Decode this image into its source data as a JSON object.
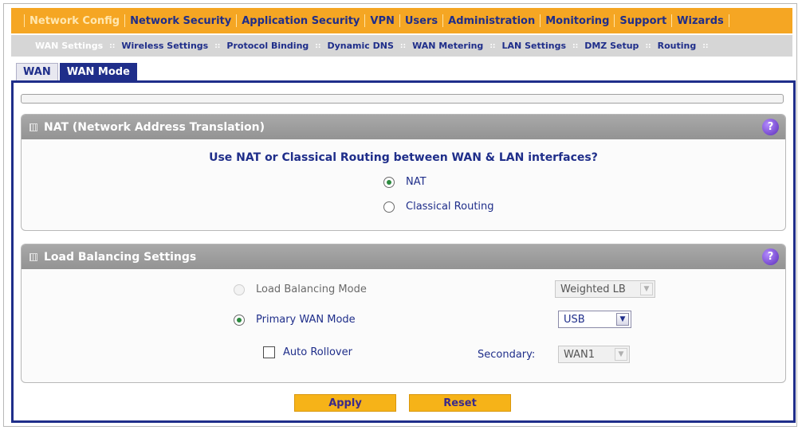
{
  "top_nav": {
    "items": [
      {
        "label": "Network Config",
        "active": true
      },
      {
        "label": "Network Security",
        "active": false
      },
      {
        "label": "Application Security",
        "active": false
      },
      {
        "label": "VPN",
        "active": false
      },
      {
        "label": "Users",
        "active": false
      },
      {
        "label": "Administration",
        "active": false
      },
      {
        "label": "Monitoring",
        "active": false
      },
      {
        "label": "Support",
        "active": false
      },
      {
        "label": "Wizards",
        "active": false
      }
    ]
  },
  "sub_nav": {
    "items": [
      {
        "label": "WAN Settings",
        "active": true
      },
      {
        "label": "Wireless Settings",
        "active": false
      },
      {
        "label": "Protocol Binding",
        "active": false
      },
      {
        "label": "Dynamic DNS",
        "active": false
      },
      {
        "label": "WAN Metering",
        "active": false
      },
      {
        "label": "LAN Settings",
        "active": false
      },
      {
        "label": "DMZ Setup",
        "active": false
      },
      {
        "label": "Routing",
        "active": false
      }
    ]
  },
  "tabs": {
    "wan": "WAN",
    "wan_mode": "WAN Mode"
  },
  "nat_section": {
    "title": "NAT (Network Address Translation)",
    "question": "Use NAT or Classical Routing between WAN & LAN interfaces?",
    "options": {
      "nat": "NAT",
      "classical": "Classical Routing"
    },
    "selected": "NAT",
    "help_glyph": "?"
  },
  "lb_section": {
    "title": "Load Balancing Settings",
    "help_glyph": "?",
    "load_balancing_mode_label": "Load Balancing Mode",
    "load_balancing_mode_value": "Weighted LB",
    "primary_wan_mode_label": "Primary WAN Mode",
    "primary_wan_mode_value": "USB",
    "auto_rollover_label": "Auto Rollover",
    "secondary_label": "Secondary:",
    "secondary_value": "WAN1"
  },
  "buttons": {
    "apply": "Apply",
    "reset": "Reset"
  },
  "colors": {
    "brand_orange": "#f5a623",
    "navy": "#1f2e8a",
    "panel_header": "#a0a0a0",
    "button_yellow": "#f6b318"
  }
}
